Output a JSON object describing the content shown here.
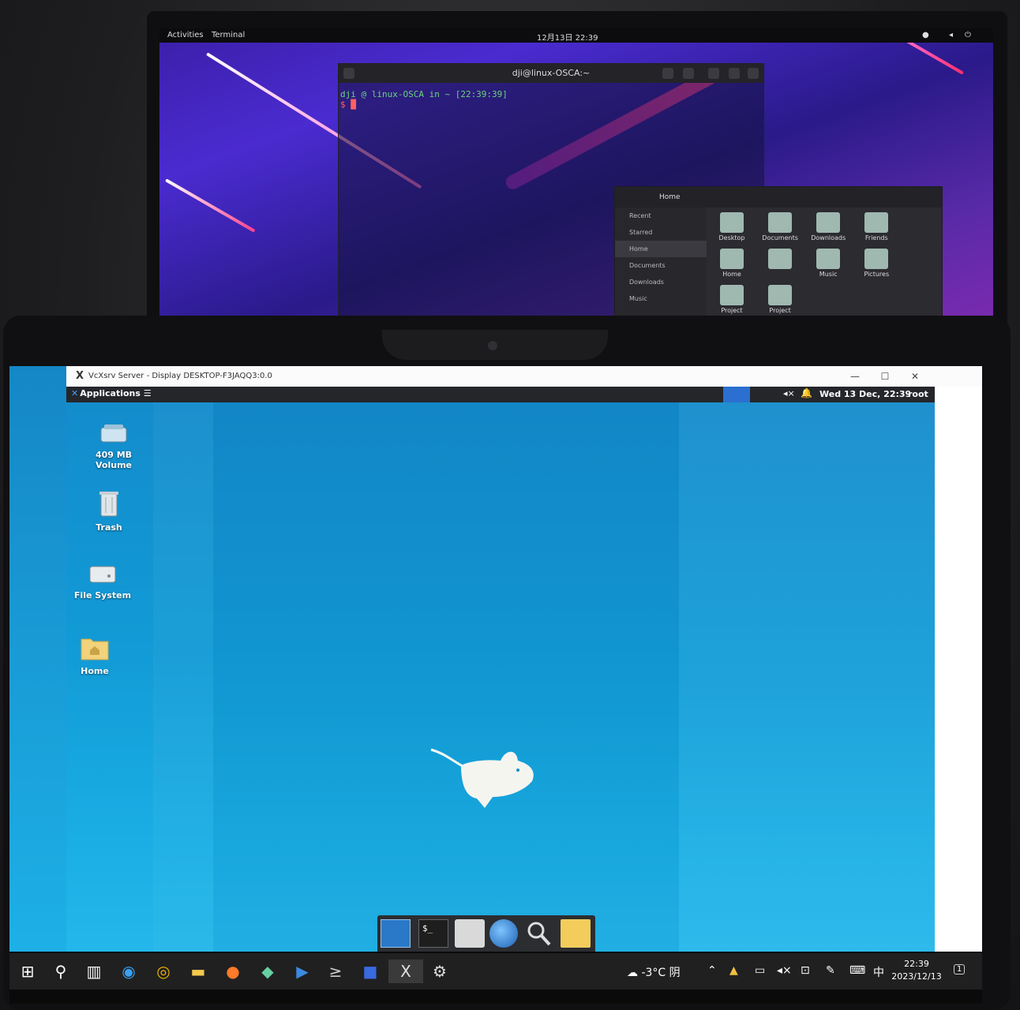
{
  "back_monitor": {
    "topbar": {
      "activities": "Activities",
      "app": "Terminal",
      "clock": "12月13日 22:39"
    },
    "terminal": {
      "title": "dji@linux-OSCA:~",
      "prompt": "dji @ linux-OSCA in ~ [22:39:39]",
      "cursor": "$ █"
    },
    "files": {
      "title": "Home",
      "sidebar": [
        "Recent",
        "Starred",
        "Home",
        "Documents",
        "Downloads",
        "Music"
      ],
      "items": [
        "Desktop",
        "Documents",
        "Downloads",
        "Friends",
        "Home",
        "",
        "Music",
        "Pictures",
        "Project",
        "Project"
      ]
    }
  },
  "vcxsrv": {
    "title": "VcXsrv Server - Display DESKTOP-F3JAQQ3:0.0",
    "controls": {
      "minimize": "—",
      "maximize": "☐",
      "close": "✕"
    }
  },
  "xfce_panel": {
    "applications": "Applications",
    "clock": "Wed 13 Dec, 22:39",
    "user": "root"
  },
  "desktop_icons": [
    {
      "label_line1": "409 MB",
      "label_line2": "Volume"
    },
    {
      "label_line1": "Trash",
      "label_line2": ""
    },
    {
      "label_line1": "File System",
      "label_line2": ""
    },
    {
      "label_line1": "Home",
      "label_line2": ""
    }
  ],
  "dock": {
    "terminal_glyph": "$_"
  },
  "windows_taskbar": {
    "weather": "-3°C 阴",
    "ime": "中",
    "time": "22:39",
    "date": "2023/12/13",
    "notification_count": "1"
  }
}
